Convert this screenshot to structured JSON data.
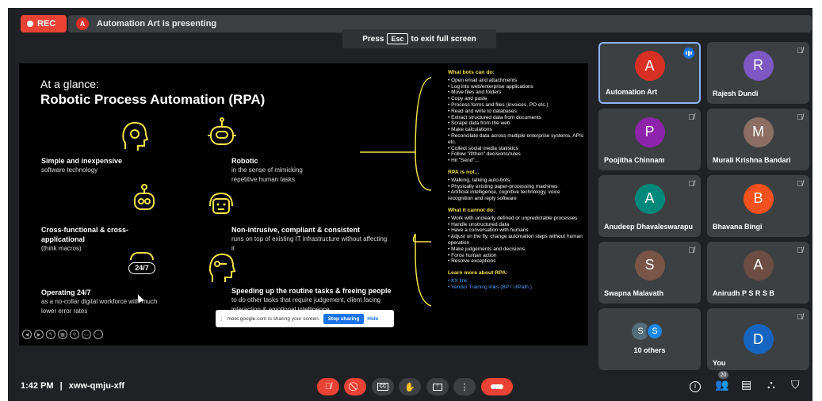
{
  "top_bar": {
    "rec_label": "REC",
    "presenter_initial": "A",
    "presenting_text": "Automation Art is presenting"
  },
  "fullscreen_tip": {
    "press": "Press",
    "key": "Esc",
    "rest": "to exit full screen"
  },
  "slide": {
    "at_a_glance": "At a glance:",
    "title": "Robotic Process Automation (RPA)",
    "features": [
      {
        "heading": "Simple and inexpensive",
        "desc": "software technology"
      },
      {
        "heading": "Robotic",
        "desc": "in the sense of mimicking repetitive human tasks"
      },
      {
        "heading": "Cross-functional & cross-applicational",
        "desc": "(think macros)"
      },
      {
        "heading": "Non-intrusive, compliant & consistent",
        "desc": "runs on top of existing IT infrastructure without affecting it"
      },
      {
        "heading": "Operating 24/7",
        "desc": "as a no-collar digital workforce with much lower error rates"
      },
      {
        "heading": "Speeding up the routine tasks & freeing people",
        "desc": "to do other tasks that require judgement, client facing interaction & emotional intelligence"
      }
    ],
    "icon_24_7": "24/7",
    "sections": {
      "can_do": {
        "heading": "What bots can do:",
        "items": [
          "Open email and attachments",
          "Log into web/enterprise applications",
          "Move files and folders",
          "Copy and paste",
          "Process forms and files (invoices, PO etc.)",
          "Read and write to databases",
          "Extract structured data from documents",
          "Scrape data from the web",
          "Make calculations",
          "Reconcilate data across multiple enterprise systems, APIs etc.",
          "Collect social media statistics",
          "Follow \"if/then\" decisions/rules",
          "Hit \"Send\"..."
        ]
      },
      "is_not": {
        "heading": "RPA is not...",
        "items": [
          "Walking, talking auto-bots",
          "Physically existing paper-processing machines",
          "Artificial intelligence, cognitive technology, voice recognition and reply software"
        ]
      },
      "cannot_do": {
        "heading": "What it cannot do:",
        "items": [
          "Work with unclearly defined or unpredictable processes",
          "Handle unstructured data",
          "Have a conversation with humans",
          "Adjust on the fly, change automation steps without human operation",
          "Make judgements and decisions",
          "Force human action",
          "Resolve exceptions"
        ]
      },
      "learn_more": {
        "heading": "Learn more about RPA:",
        "links": [
          "KX link",
          "Vendor Training links (BP / UiPath )"
        ]
      }
    }
  },
  "share_banner": {
    "text": "meet.google.com is sharing your screen.",
    "stop": "Stop sharing",
    "hide": "Hide"
  },
  "participants": [
    {
      "name": "Automation Art",
      "initial": "A",
      "color": "#d93025",
      "active": true
    },
    {
      "name": "Rajesh Dundi",
      "initial": "R",
      "color": "#7e57c2"
    },
    {
      "name": "Poojitha Chinnam",
      "initial": "P",
      "color": "#8e24aa"
    },
    {
      "name": "Murali Krishna Bandari",
      "initial": "M",
      "color": "#8d6e63"
    },
    {
      "name": "Anudeep Dhavaleswarapu",
      "initial": "A",
      "color": "#00897b"
    },
    {
      "name": "Bhavana Bingi",
      "initial": "B",
      "color": "#f4511e"
    },
    {
      "name": "Swapna Malavath",
      "initial": "S",
      "color": "#795548"
    },
    {
      "name": "Anirudh P S R S B",
      "initial": "A",
      "color": "#6d4c41"
    },
    {
      "name": "10 others",
      "initials": [
        "S",
        "S"
      ],
      "colors": [
        "#546e7a",
        "#1e88e5"
      ]
    },
    {
      "name": "You",
      "initial": "D",
      "color": "#1565c0"
    }
  ],
  "bottom_bar": {
    "time": "1:42 PM",
    "separator": "|",
    "meeting_code": "xww-qmju-xff",
    "people_count": "20"
  }
}
